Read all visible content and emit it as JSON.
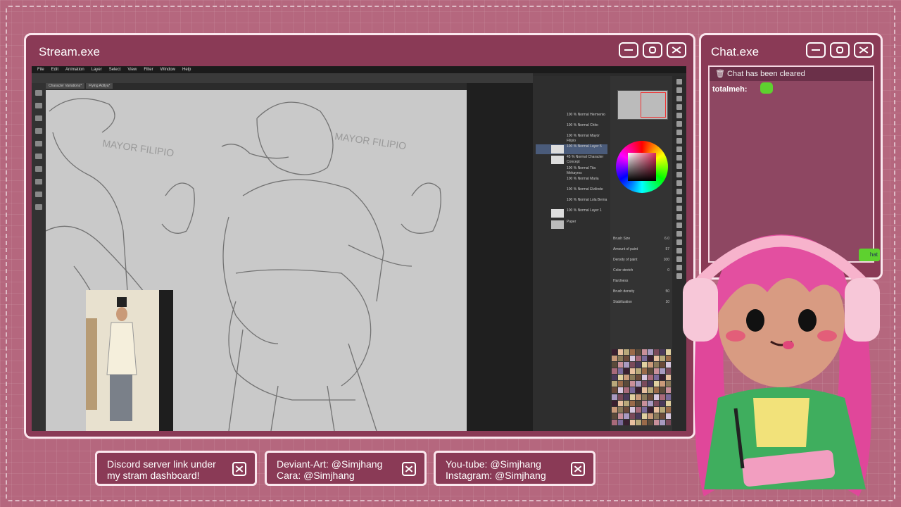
{
  "stream_window": {
    "title": "Stream.exe"
  },
  "chat_window": {
    "title": "Chat.exe",
    "notice": "Chat has been cleared",
    "message_user": "totalmeh:",
    "button_label": "hat"
  },
  "app": {
    "menu": [
      "File",
      "Edit",
      "Animation",
      "Layer",
      "Select",
      "View",
      "Filter",
      "Window",
      "Help"
    ],
    "tabs": [
      "Character Variations*",
      "Flying Aditya*"
    ],
    "layers": [
      {
        "label": "100 % Normal Hermenio"
      },
      {
        "label": "100 % Normal Chito"
      },
      {
        "label": "100 % Normal Mayor Filipio"
      },
      {
        "label": "100 % Normal Layer 5"
      },
      {
        "label": "45 % Normal Character Concept"
      },
      {
        "label": "100 % Normal Tita Mekayros"
      },
      {
        "label": "100 % Normal Maria"
      },
      {
        "label": "100 % Normal Elvilinde"
      },
      {
        "label": "100 % Normal Lola Berna"
      },
      {
        "label": "100 % Normal Layer 1"
      },
      {
        "label": "Paper"
      }
    ],
    "tool_props": [
      {
        "name": "Brush Size",
        "val": "6.0"
      },
      {
        "name": "Amount of paint",
        "val": "57"
      },
      {
        "name": "Density of paint",
        "val": "100"
      },
      {
        "name": "Color stretch",
        "val": "0"
      },
      {
        "name": "Hardness",
        "val": ""
      },
      {
        "name": "Brush density",
        "val": "50"
      },
      {
        "name": "Stabilization",
        "val": "10"
      }
    ],
    "canvas_labels": [
      "MAYOR FILIPIO",
      "MAYOR FILIPIO"
    ]
  },
  "bottom_links": [
    {
      "text": "Discord server link under\nmy stram dashboard!"
    },
    {
      "text": "Deviant-Art: @Simjhang\nCara: @Simjhang"
    },
    {
      "text": "You-tube: @Simjhang\nInstagram: @Simjhang"
    }
  ],
  "colors": {
    "background": "#b5677e",
    "window": "#8a3a56",
    "border": "#fbe7ee",
    "emote": "#5ed12f"
  }
}
